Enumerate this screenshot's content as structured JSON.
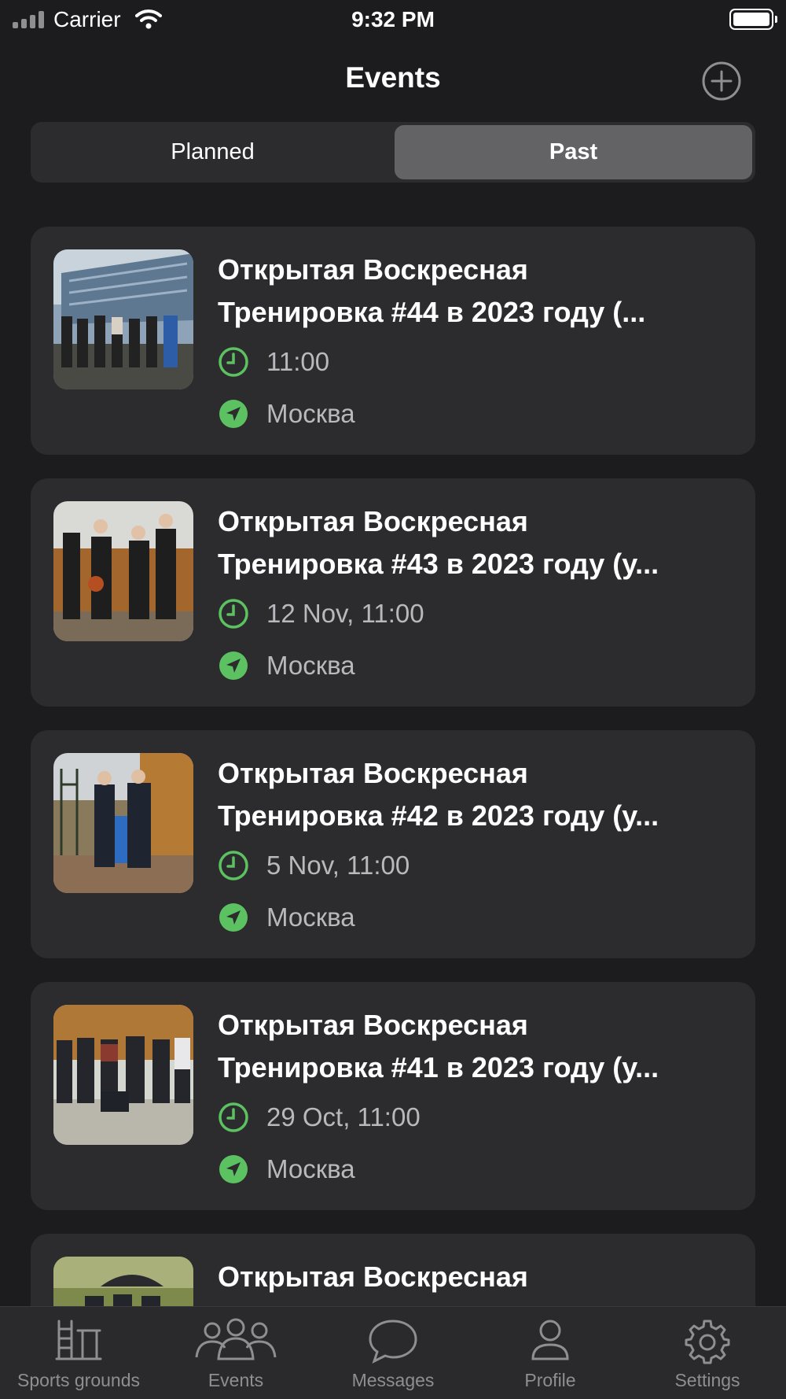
{
  "status_bar": {
    "carrier": "Carrier",
    "time": "9:32 PM",
    "signal_icon": "signal-bars-icon",
    "wifi_icon": "wifi-icon",
    "battery_icon": "battery-icon"
  },
  "nav": {
    "title": "Events",
    "add_icon": "plus-circle-icon"
  },
  "segments": {
    "items": [
      {
        "label": "Planned",
        "selected": false
      },
      {
        "label": "Past",
        "selected": true
      }
    ]
  },
  "accent_color": "#5cc261",
  "events": [
    {
      "title_line1": "Открытая Воскресная",
      "title_line2": "Тренировка #44 в 2023 году (...",
      "time": "11:00",
      "place": "Москва"
    },
    {
      "title_line1": "Открытая Воскресная",
      "title_line2": "Тренировка #43 в 2023 году (у...",
      "time": "12 Nov, 11:00",
      "place": "Москва"
    },
    {
      "title_line1": "Открытая Воскресная",
      "title_line2": "Тренировка #42 в 2023 году (у...",
      "time": "5 Nov, 11:00",
      "place": "Москва"
    },
    {
      "title_line1": "Открытая Воскресная",
      "title_line2": "Тренировка #41 в 2023 году (у...",
      "time": "29 Oct, 11:00",
      "place": "Москва"
    },
    {
      "title_line1": "Открытая Воскресная",
      "title_line2": "",
      "time": "",
      "place": ""
    }
  ],
  "tab_bar": {
    "items": [
      {
        "label": "Sports grounds",
        "icon": "sports-ground-icon"
      },
      {
        "label": "Events",
        "icon": "people-group-icon"
      },
      {
        "label": "Messages",
        "icon": "chat-bubble-icon"
      },
      {
        "label": "Profile",
        "icon": "person-icon"
      },
      {
        "label": "Settings",
        "icon": "gear-icon"
      }
    ]
  }
}
